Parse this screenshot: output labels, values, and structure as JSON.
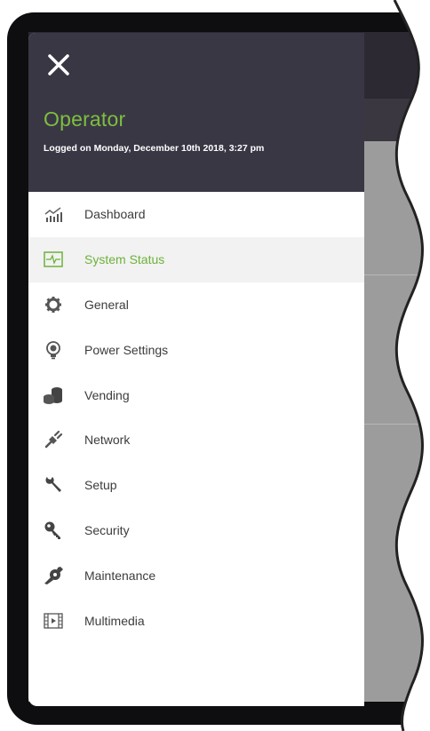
{
  "drawer": {
    "user_name": "Operator",
    "login_info": "Logged on Monday, December 10th 2018, 3:27 pm",
    "items": [
      {
        "label": "Dashboard",
        "icon": "chart-icon"
      },
      {
        "label": "System Status",
        "icon": "pulse-icon",
        "active": true
      },
      {
        "label": "General",
        "icon": "gear-icon"
      },
      {
        "label": "Power Settings",
        "icon": "bulb-icon"
      },
      {
        "label": "Vending",
        "icon": "coins-icon"
      },
      {
        "label": "Network",
        "icon": "plug-icon"
      },
      {
        "label": "Setup",
        "icon": "wrench-icon"
      },
      {
        "label": "Security",
        "icon": "key-icon"
      },
      {
        "label": "Maintenance",
        "icon": "tools-icon"
      },
      {
        "label": "Multimedia",
        "icon": "film-icon"
      }
    ]
  },
  "colors": {
    "header_bg": "#3a3745",
    "accent": "#7dbf3f",
    "active_bg": "#f2f2f2"
  }
}
